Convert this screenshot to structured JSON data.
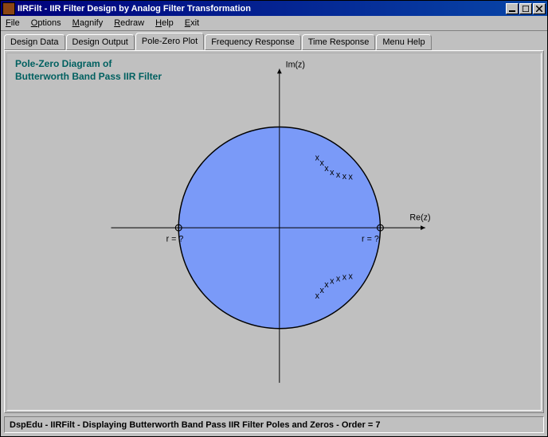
{
  "titlebar": {
    "text": "IIRFilt - IIR Filter Design by Analog Filter Transformation"
  },
  "menubar": {
    "items": [
      {
        "label": "File",
        "underline": 0
      },
      {
        "label": "Options",
        "underline": 0
      },
      {
        "label": "Magnify",
        "underline": 0
      },
      {
        "label": "Redraw",
        "underline": 0
      },
      {
        "label": "Help",
        "underline": 0
      },
      {
        "label": "Exit",
        "underline": 0
      }
    ]
  },
  "tabs": {
    "items": [
      "Design Data",
      "Design Output",
      "Pole-Zero Plot",
      "Frequency Response",
      "Time Response",
      "Menu Help"
    ],
    "active_index": 2
  },
  "plot": {
    "title_line1": "Pole-Zero Diagram of",
    "title_line2": "Butterworth Band Pass IIR Filter",
    "im_label": "Im(z)",
    "re_label": "Re(z)",
    "r_left_label": "r = ?",
    "r_right_label": "r = ?"
  },
  "chart_data": {
    "type": "pole-zero",
    "unit_circle_radius": 1.0,
    "zeros": [
      {
        "x": 1.0,
        "y": 0.0
      },
      {
        "x": -1.0,
        "y": 0.0
      }
    ],
    "zero_multiplicity": 7,
    "poles_approx": [
      {
        "x": 0.68,
        "y": 0.68
      },
      {
        "x": 0.73,
        "y": 0.62
      },
      {
        "x": 0.78,
        "y": 0.57
      },
      {
        "x": 0.83,
        "y": 0.52
      },
      {
        "x": 0.86,
        "y": 0.47
      },
      {
        "x": 0.89,
        "y": 0.41
      },
      {
        "x": 0.92,
        "y": 0.35
      },
      {
        "x": 0.68,
        "y": -0.68
      },
      {
        "x": 0.73,
        "y": -0.62
      },
      {
        "x": 0.78,
        "y": -0.57
      },
      {
        "x": 0.83,
        "y": -0.52
      },
      {
        "x": 0.86,
        "y": -0.47
      },
      {
        "x": 0.89,
        "y": -0.41
      },
      {
        "x": 0.92,
        "y": -0.35
      }
    ],
    "xlabel": "Re(z)",
    "ylabel": "Im(z)",
    "xlim": [
      -1.6,
      1.6
    ],
    "ylim": [
      -1.6,
      1.6
    ]
  },
  "statusbar": {
    "text": "DspEdu - IIRFilt - Displaying Butterworth Band Pass IIR Filter Poles and Zeros - Order = 7"
  }
}
